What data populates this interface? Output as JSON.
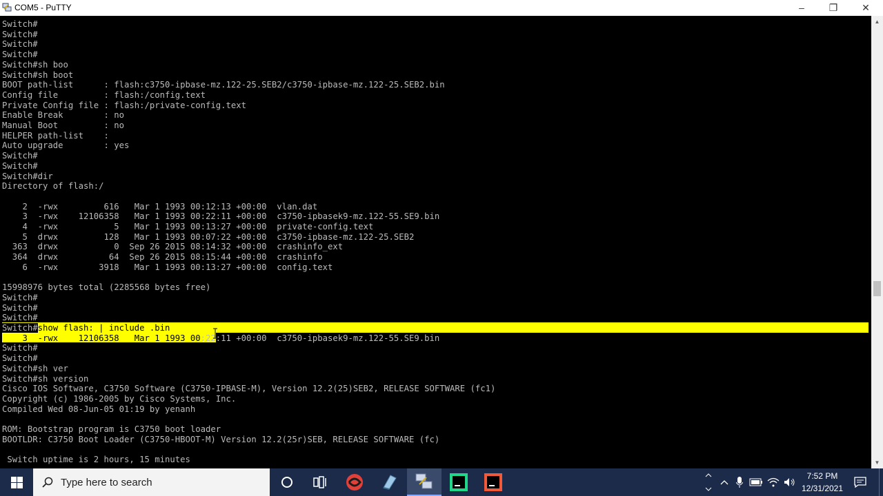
{
  "window": {
    "title": "COM5 - PuTTY",
    "controls": {
      "minimize": "–",
      "maximize": "❐",
      "close": "✕"
    }
  },
  "terminal": {
    "lines": [
      "Switch#",
      "Switch#",
      "Switch#",
      "Switch#",
      "Switch#sh boo",
      "Switch#sh boot",
      "BOOT path-list      : flash:c3750-ipbase-mz.122-25.SEB2/c3750-ipbase-mz.122-25.SEB2.bin",
      "Config file         : flash:/config.text",
      "Private Config file : flash:/private-config.text",
      "Enable Break        : no",
      "Manual Boot         : no",
      "HELPER path-list    :",
      "Auto upgrade        : yes",
      "Switch#",
      "Switch#",
      "Switch#dir",
      "Directory of flash:/",
      "",
      "    2  -rwx         616   Mar 1 1993 00:12:13 +00:00  vlan.dat",
      "    3  -rwx    12106358   Mar 1 1993 00:22:11 +00:00  c3750-ipbasek9-mz.122-55.SE9.bin",
      "    4  -rwx           5   Mar 1 1993 00:13:27 +00:00  private-config.text",
      "    5  drwx         128   Mar 1 1993 00:07:22 +00:00  c3750-ipbase-mz.122-25.SEB2",
      "  363  drwx           0  Sep 26 2015 08:14:32 +00:00  crashinfo_ext",
      "  364  drwx          64  Sep 26 2015 08:15:44 +00:00  crashinfo",
      "    6  -rwx        3918   Mar 1 1993 00:13:27 +00:00  config.text",
      "",
      "15998976 bytes total (2285568 bytes free)",
      "Switch#",
      "Switch#",
      "Switch#",
      "Switch#show flash: | include .bin",
      "    3  -rwx    12106358   Mar 1 1993 00:22:11 +00:00  c3750-ipbasek9-mz.122-55.SE9.bin",
      "Switch#",
      "Switch#",
      "Switch#sh ver",
      "Switch#sh version",
      "Cisco IOS Software, C3750 Software (C3750-IPBASE-M), Version 12.2(25)SEB2, RELEASE SOFTWARE (fc1)",
      "Copyright (c) 1986-2005 by Cisco Systems, Inc.",
      "Compiled Wed 08-Jun-05 01:19 by yenanh",
      "",
      "ROM: Bootstrap program is C3750 boot loader",
      "BOOTLDR: C3750 Boot Loader (C3750-HBOOT-M) Version 12.2(25r)SEB, RELEASE SOFTWARE (fc)",
      "",
      " Switch uptime is 2 hours, 15 minutes"
    ],
    "selection_highlight_color": "#ffff00",
    "text_color": "#bbbbbb",
    "background_color": "#000000"
  },
  "taskbar": {
    "search_placeholder": "Type here to search",
    "clock_time": "7:52 PM",
    "clock_date": "12/31/2021",
    "pinned_icons": [
      "windows-start-icon",
      "cortana-icon",
      "task-view-icon",
      "webex-icon",
      "notes-icon",
      "putty-icon",
      "pycharm-icon",
      "clion-icon"
    ],
    "tray_icons": [
      "chevron-up-icon",
      "microphone-icon",
      "battery-icon",
      "wifi-icon",
      "volume-icon",
      "notification-icon"
    ],
    "background_color": "#1c2b4a"
  }
}
